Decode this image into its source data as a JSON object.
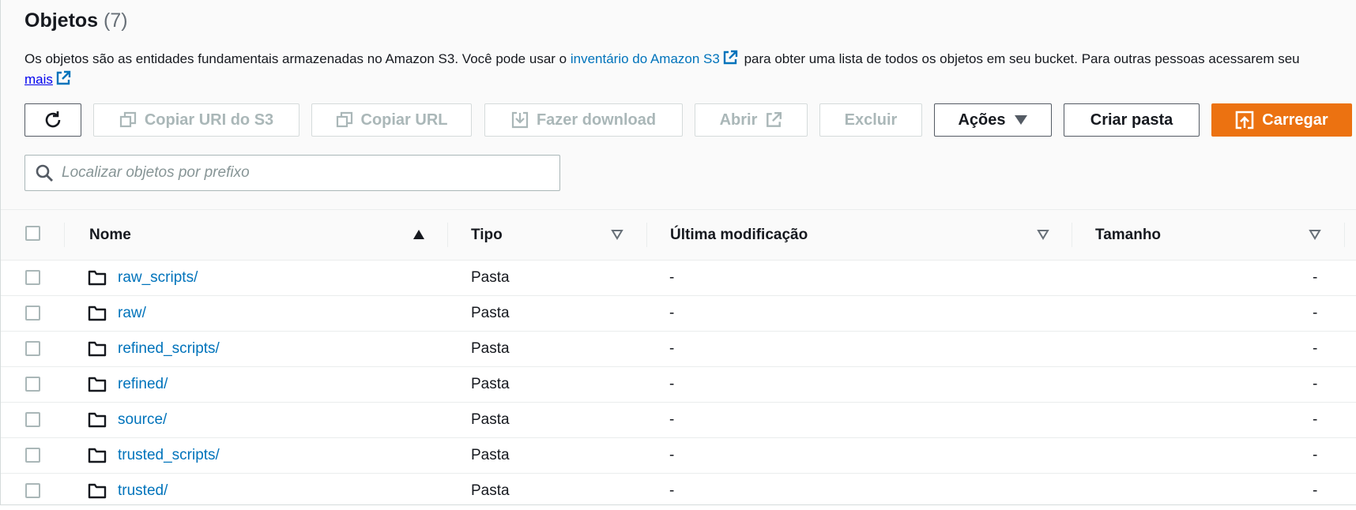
{
  "header": {
    "title": "Objetos",
    "count": "(7)",
    "description_before": "Os objetos são as entidades fundamentais armazenadas no Amazon S3. Você pode usar o ",
    "description_link": "inventário do Amazon S3",
    "description_after": " para obter uma lista de todos os objetos em seu bucket. Para outras pessoas acessarem seu",
    "more_link": "mais"
  },
  "toolbar": {
    "refresh_icon": "refresh-icon",
    "copy_s3_uri": "Copiar URI do S3",
    "copy_url": "Copiar URL",
    "download": "Fazer download",
    "open": "Abrir",
    "delete": "Excluir",
    "actions": "Ações",
    "create_folder": "Criar pasta",
    "upload": "Carregar"
  },
  "search": {
    "placeholder": "Localizar objetos por prefixo",
    "value": ""
  },
  "table": {
    "columns": [
      "Nome",
      "Tipo",
      "Última modificação",
      "Tamanho"
    ],
    "rows": [
      {
        "name": "raw_scripts/",
        "type": "Pasta",
        "modified": "-",
        "size": "-"
      },
      {
        "name": "raw/",
        "type": "Pasta",
        "modified": "-",
        "size": "-"
      },
      {
        "name": "refined_scripts/",
        "type": "Pasta",
        "modified": "-",
        "size": "-"
      },
      {
        "name": "refined/",
        "type": "Pasta",
        "modified": "-",
        "size": "-"
      },
      {
        "name": "source/",
        "type": "Pasta",
        "modified": "-",
        "size": "-"
      },
      {
        "name": "trusted_scripts/",
        "type": "Pasta",
        "modified": "-",
        "size": "-"
      },
      {
        "name": "trusted/",
        "type": "Pasta",
        "modified": "-",
        "size": "-"
      }
    ]
  },
  "colors": {
    "link": "#0073bb",
    "primary": "#ec7211",
    "disabled": "#aab7b8"
  }
}
